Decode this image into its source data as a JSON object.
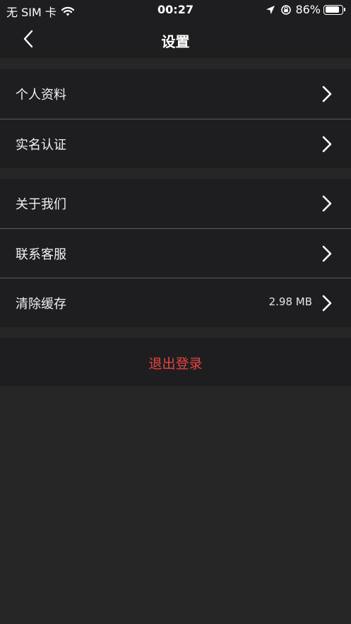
{
  "status_bar": {
    "carrier": "无 SIM 卡",
    "time": "00:27",
    "battery": "86%",
    "battery_level": 0.86
  },
  "nav": {
    "title": "设置"
  },
  "settings": {
    "group1": [
      {
        "label": "个人资料"
      },
      {
        "label": "实名认证"
      }
    ],
    "group2": [
      {
        "label": "关于我们"
      },
      {
        "label": "联系客服"
      },
      {
        "label": "清除缓存",
        "value": "2.98 MB"
      }
    ]
  },
  "logout": {
    "label": "退出登录",
    "color": "#e8433e"
  },
  "colors": {
    "background": "#262626",
    "surface": "#1e1e20",
    "divider": "#5a5a5c"
  }
}
